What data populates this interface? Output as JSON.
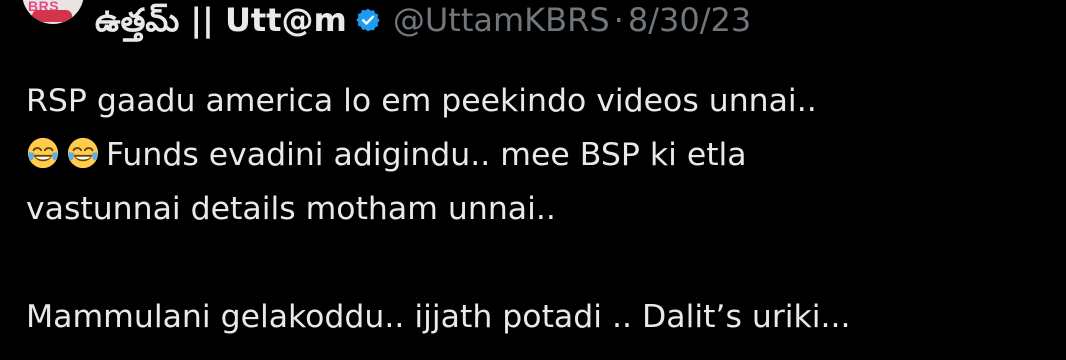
{
  "tweet": {
    "display_name": "ఉత్తమ్ || Utt@m",
    "handle": "@UttamKBRS",
    "separator": "·",
    "date": "8/30/23",
    "avatar_logo_text": "BRS",
    "lines": [
      "RSP gaadu america lo em peekindo videos unnai..",
      "Funds evadini adigindu.. mee BSP ki etla",
      "vastunnai details motham unnai..",
      "",
      "Mammulani gelakoddu.. ijjath potadi .. Dalit’s uriki..."
    ],
    "emoji": "face-with-tears-of-joy",
    "colors": {
      "background": "#000000",
      "text": "#e7e9ea",
      "secondary": "#71767b",
      "verified": "#1d9bf0"
    }
  }
}
